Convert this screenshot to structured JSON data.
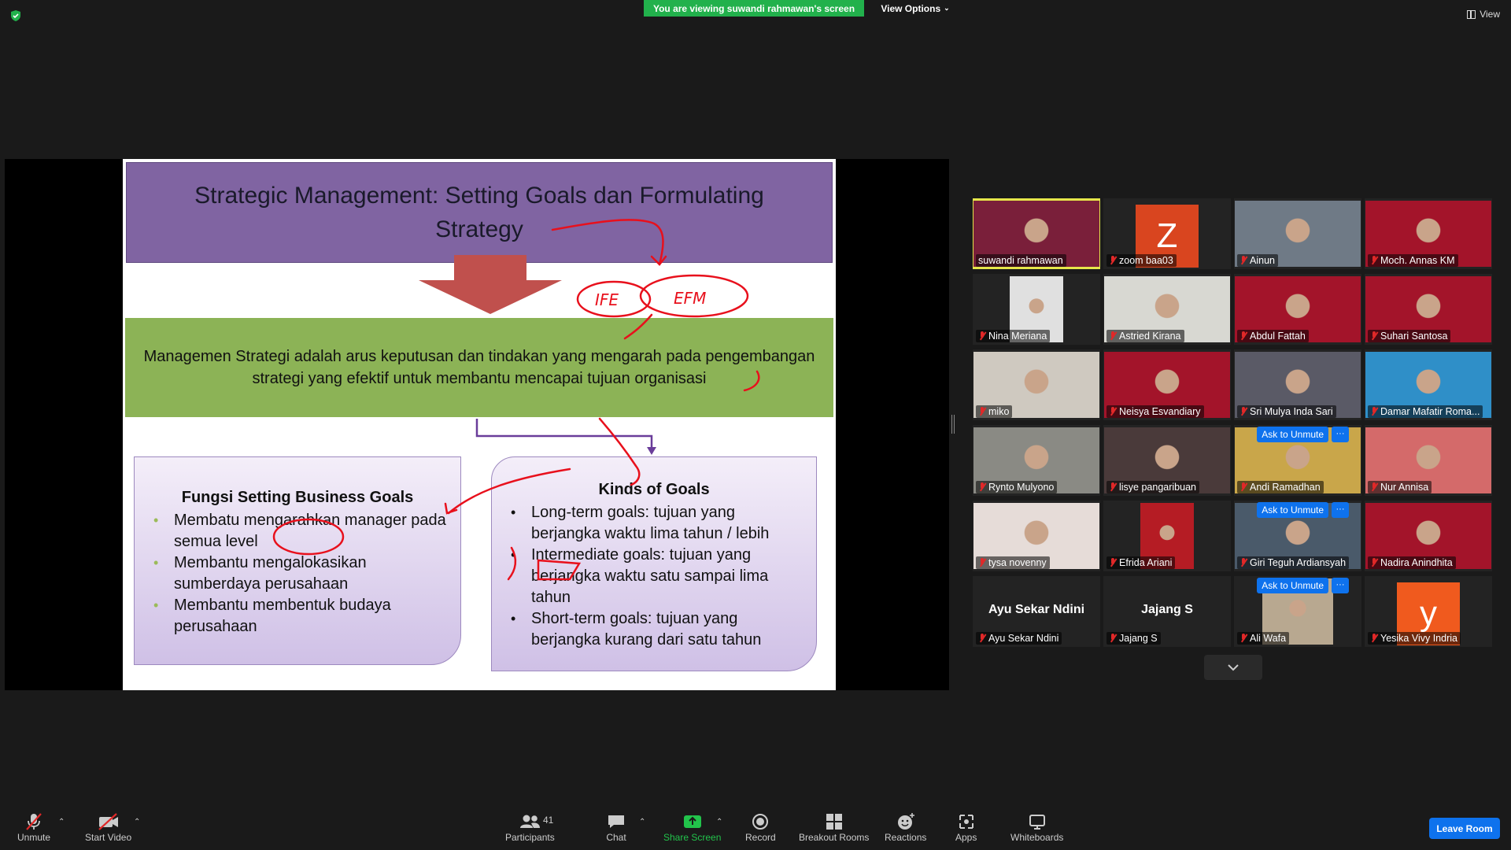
{
  "top": {
    "banner": "You are viewing suwandi rahmawan's screen",
    "view_options": "View Options",
    "view": "View"
  },
  "slide": {
    "title": "Strategic Management: Setting Goals dan Formulating Strategy",
    "definition": "Managemen Strategi adalah arus keputusan dan tindakan yang mengarah pada pengembangan strategi yang efektif untuk membantu mencapai tujuan organisasi",
    "left_box": {
      "heading": "Fungsi Setting Business Goals",
      "items": [
        "Membatu mengarahkan manager pada semua level",
        "Membantu mengalokasikan sumberdaya perusahaan",
        "Membantu membentuk budaya perusahaan"
      ]
    },
    "right_box": {
      "heading": "Kinds of Goals",
      "items": [
        "Long-term goals: tujuan yang berjangka waktu lima tahun / lebih",
        "Intermediate goals: tujuan yang berjangka waktu satu sampai lima tahun",
        "Short-term goals: tujuan yang berjangka kurang dari satu tahun"
      ]
    },
    "annotations": [
      "IFE",
      "EFM"
    ]
  },
  "gallery": [
    {
      "name": "suwandi rahmawan",
      "muted": false,
      "active": true,
      "bg": "#7a1f3a"
    },
    {
      "name": "zoom baa03",
      "muted": true,
      "letter": "Z",
      "letter_bg": "#d9451f"
    },
    {
      "name": "Ainun",
      "muted": true,
      "bg": "#6f7a86"
    },
    {
      "name": "Moch. Annas KM",
      "muted": true,
      "bg": "#a3142a"
    },
    {
      "name": "Nina Meriana",
      "muted": true,
      "bg": "#e0e0e0"
    },
    {
      "name": "Astried Kirana",
      "muted": true,
      "bg": "#d8d8d2"
    },
    {
      "name": "Abdul Fattah",
      "muted": true,
      "bg": "#a3142a"
    },
    {
      "name": "Suhari Santosa",
      "muted": true,
      "bg": "#a3142a"
    },
    {
      "name": "miko",
      "muted": true,
      "bg": "#cfc9c0"
    },
    {
      "name": "Neisya Esvandiary",
      "muted": true,
      "bg": "#a3142a"
    },
    {
      "name": "Sri Mulya Inda Sari",
      "muted": true,
      "bg": "#5a5a66"
    },
    {
      "name": "Damar Mafatir Roma...",
      "muted": true,
      "bg": "#2f8fc8"
    },
    {
      "name": "Rynto Mulyono",
      "muted": true,
      "bg": "#8a8a84"
    },
    {
      "name": "lisye pangaribuan",
      "muted": true,
      "bg": "#4a3a3a"
    },
    {
      "name": "Andi Ramadhan",
      "muted": true,
      "bg": "#c9a64a",
      "ask": "Ask to Unmute"
    },
    {
      "name": "Nur Annisa",
      "muted": true,
      "bg": "#d46a6a"
    },
    {
      "name": "tysa novenny",
      "muted": true,
      "bg": "#e6dcd8"
    },
    {
      "name": "Efrida Ariani",
      "muted": true,
      "bg": "#b51c24"
    },
    {
      "name": "Giri Teguh Ardiansyah",
      "muted": true,
      "bg": "#4a5a6a",
      "ask": "Ask to Unmute"
    },
    {
      "name": "Nadira Anindhita",
      "muted": true,
      "bg": "#a3142a"
    },
    {
      "name": "Ayu Sekar Ndini",
      "muted": true,
      "big_name": "Ayu Sekar Ndini"
    },
    {
      "name": "Jajang S",
      "muted": true,
      "big_name": "Jajang S"
    },
    {
      "name": "Ali Wafa",
      "muted": true,
      "bg": "#b8a890",
      "ask": "Ask to Unmute"
    },
    {
      "name": "Yesika Vivy Indria",
      "muted": true,
      "letter": "y",
      "letter_bg": "#f05a1e"
    }
  ],
  "toolbar": {
    "unmute": "Unmute",
    "start_video": "Start Video",
    "participants": "Participants",
    "participants_count": "41",
    "chat": "Chat",
    "share_screen": "Share Screen",
    "record": "Record",
    "breakout_rooms": "Breakout Rooms",
    "reactions": "Reactions",
    "apps": "Apps",
    "whiteboards": "Whiteboards",
    "leave": "Leave Room"
  },
  "colors": {
    "banner_green": "#22b14c",
    "accent_blue": "#0e72ed",
    "title_purple": "#8064a2",
    "definition_green": "#8cb356",
    "ink_red": "#e8101c"
  }
}
